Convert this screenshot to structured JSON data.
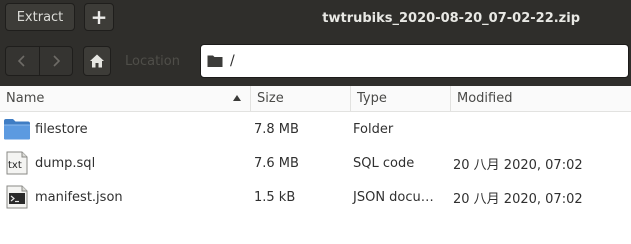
{
  "header": {
    "extract_label": "Extract",
    "add_label": "+",
    "title": "twtrubiks_2020-08-20_07-02-22.zip"
  },
  "location_bar": {
    "back_icon": "chevron-left-icon",
    "forward_icon": "chevron-right-icon",
    "home_icon": "home-icon",
    "location_label": "Location",
    "path": "/"
  },
  "columns": {
    "name": "Name",
    "size": "Size",
    "type": "Type",
    "modified": "Modified",
    "sort_icon": "sort-up-icon"
  },
  "files": [
    {
      "name": "filestore",
      "size": "7.8 MB",
      "type": "Folder",
      "modified": "",
      "icon": "folder-icon"
    },
    {
      "name": "dump.sql",
      "size": "7.6 MB",
      "type": "SQL code",
      "modified": "20 八月 2020, 07:02",
      "icon": "text-file-icon",
      "icon_text": "txt"
    },
    {
      "name": "manifest.json",
      "size": "1.5 kB",
      "type": "JSON docu…",
      "modified": "20 八月 2020, 07:02",
      "icon": "terminal-file-icon"
    }
  ]
}
